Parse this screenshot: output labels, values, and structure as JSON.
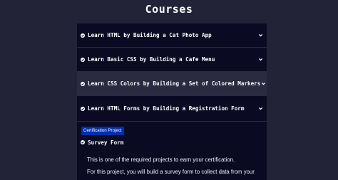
{
  "page": {
    "title": "Courses"
  },
  "courses": [
    {
      "label": "Learn HTML by Building a Cat Photo App"
    },
    {
      "label": "Learn Basic CSS by Building a Cafe Menu"
    },
    {
      "label": "Learn CSS Colors by Building a Set of Colored Markers"
    },
    {
      "label": "Learn HTML Forms by Building a Registration Form"
    }
  ],
  "expanded": {
    "badge": "Certification Project",
    "project_title": "Survey Form",
    "paragraphs": [
      "This is one of the required projects to earn your certification.",
      "For this project, you will build a survey form to collect data from your"
    ]
  },
  "icons": {
    "check": "check-circle-icon",
    "chevron": "chevron-down-icon"
  },
  "colors": {
    "background": "#232338",
    "panel": "#0a0a23",
    "active_row": "#2a2a40",
    "badge": "#002ead"
  }
}
